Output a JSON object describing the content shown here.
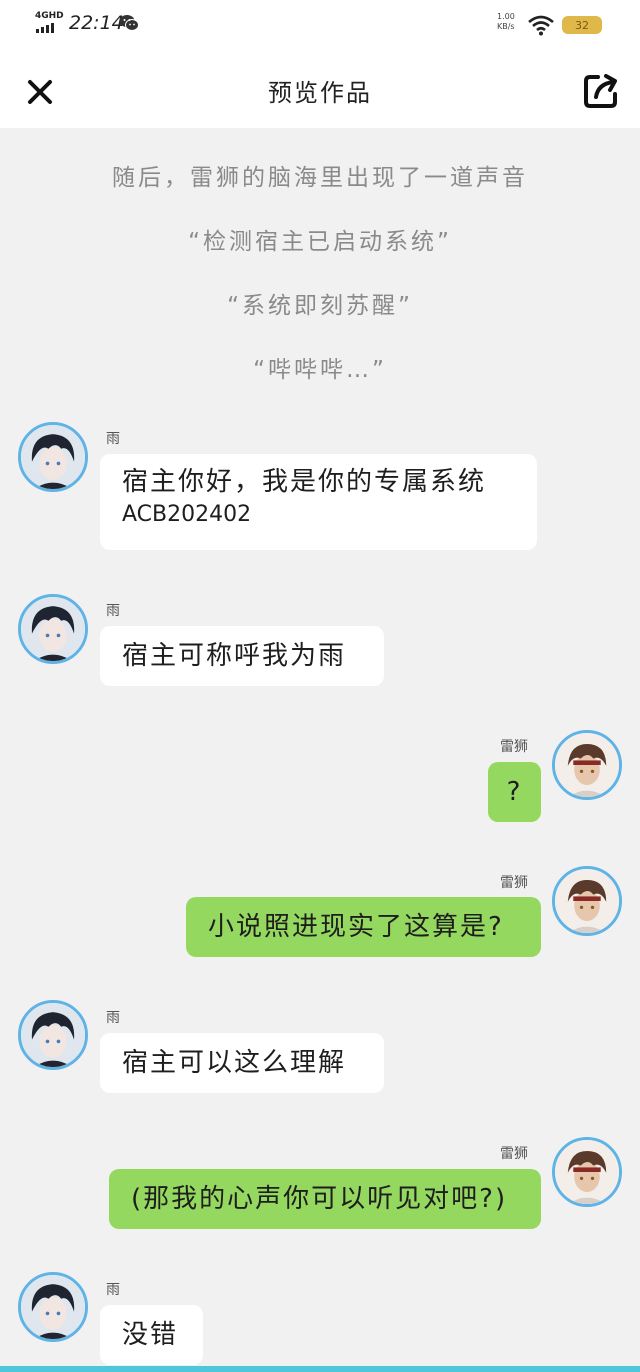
{
  "status_bar": {
    "network": "4GHD",
    "time": "22:14",
    "speed_value": "1.00",
    "speed_unit": "KB/s",
    "battery": "32"
  },
  "header": {
    "close_icon": "close-icon",
    "title": "预览作品",
    "share_icon": "share-icon"
  },
  "narration": [
    "随后，雷狮的脑海里出现了一道声音",
    "“检测宿主已启动系统”",
    "“系统即刻苏醒”",
    "“哔哔哔…”"
  ],
  "messages": [
    {
      "side": "left",
      "sender": "雨",
      "text": "宿主你好，我是你的专属系统",
      "text2": "ACB202402"
    },
    {
      "side": "left",
      "sender": "雨",
      "text": "宿主可称呼我为雨"
    },
    {
      "side": "right",
      "sender": "雷狮",
      "text": "?"
    },
    {
      "side": "right",
      "sender": "雷狮",
      "text": "小说照进现实了这算是?"
    },
    {
      "side": "left",
      "sender": "雨",
      "text": "宿主可以这么理解"
    },
    {
      "side": "right",
      "sender": "雷狮",
      "text": "(那我的心声你可以听见对吧?)"
    },
    {
      "side": "left",
      "sender": "雨",
      "text": "没错"
    }
  ],
  "colors": {
    "background": "#f1f1f1",
    "right_bubble": "#95d85f",
    "left_bubble": "#ffffff",
    "avatar_ring": "#5fb3e6",
    "narration_text": "#8a8a8a"
  }
}
